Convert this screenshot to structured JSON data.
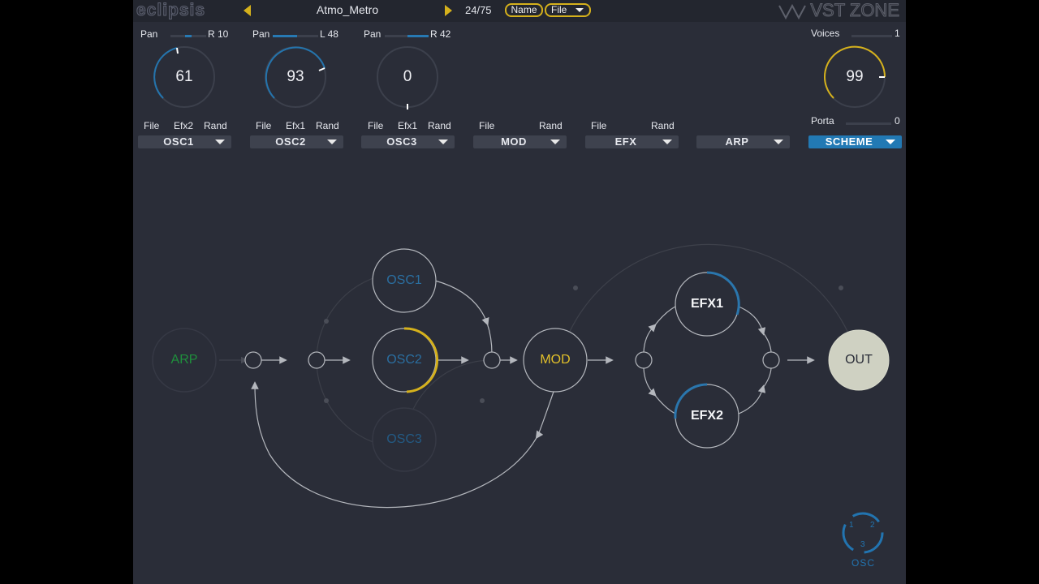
{
  "header": {
    "logo": "eclipsis",
    "preset_name": "Atmo_Metro",
    "preset_count": "24/75",
    "name_button": "Name",
    "file_button": "File",
    "watermark": "VST ZONE",
    "accent_color": "#d5b11c"
  },
  "osc1": {
    "pan_label": "Pan",
    "pan_value": "R 10",
    "pan_level": 0.55,
    "knob_value": "61",
    "file": "File",
    "efx": "Efx2",
    "rand": "Rand",
    "section": "OSC1"
  },
  "osc2": {
    "pan_label": "Pan",
    "pan_value": "L 48",
    "pan_level": 0.26,
    "knob_value": "93",
    "file": "File",
    "efx": "Efx1",
    "rand": "Rand",
    "section": "OSC2"
  },
  "osc3": {
    "pan_label": "Pan",
    "pan_value": "R 42",
    "pan_level": 0.71,
    "knob_value": "0",
    "file": "File",
    "efx": "Efx1",
    "rand": "Rand",
    "section": "OSC3"
  },
  "mod": {
    "file": "File",
    "rand": "Rand",
    "section": "MOD"
  },
  "efx": {
    "file": "File",
    "rand": "Rand",
    "section": "EFX"
  },
  "arp": {
    "section": "ARP"
  },
  "scheme": {
    "section": "SCHEME",
    "color": "#2279b4"
  },
  "global": {
    "voices_label": "Voices",
    "voices_value": "1",
    "porta_label": "Porta",
    "porta_value": "0",
    "knob_value": "99"
  },
  "scheme_view": {
    "nodes": {
      "arp": "ARP",
      "osc1": "OSC1",
      "osc2": "OSC2",
      "osc3": "OSC3",
      "mod": "MOD",
      "efx1": "EFX1",
      "efx2": "EFX2",
      "out": "OUT"
    },
    "colors": {
      "arp": "#1f8f3c",
      "osc": "#2a6ea0",
      "mod": "#e2c02a",
      "osc2_ring": "#d5b11c",
      "efx_ring": "#2a76ad",
      "out_fill": "#cfd1c2"
    }
  },
  "osc_selector": {
    "label": "OSC",
    "n1": "1",
    "n2": "2",
    "n3": "3"
  }
}
